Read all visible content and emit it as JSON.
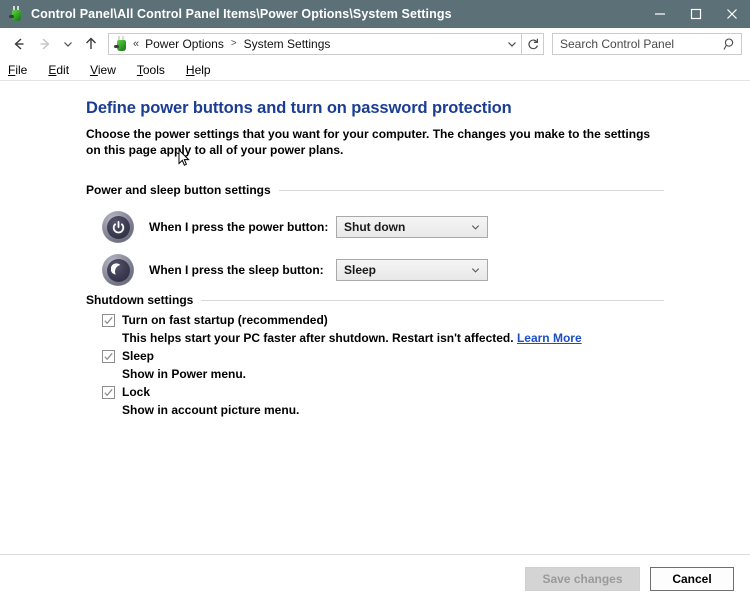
{
  "window": {
    "title": "Control Panel\\All Control Panel Items\\Power Options\\System Settings",
    "icon": "power-plug-icon",
    "titlebar_color": "#5c7078",
    "controls": {
      "minimize": "minimize-button",
      "maximize": "maximize-button",
      "close": "close-button"
    }
  },
  "navbar": {
    "back": "back-button",
    "forward": "forward-button",
    "recent": "recent-locations-button",
    "up": "up-button",
    "breadcrumb": {
      "prefix": "«",
      "items": [
        "Power Options",
        "System Settings"
      ],
      "separator": ">"
    },
    "refresh": "refresh-button",
    "search": {
      "placeholder": "Search Control Panel",
      "value": ""
    }
  },
  "menubar": {
    "items": [
      {
        "accesskey": "F",
        "rest": "ile"
      },
      {
        "accesskey": "E",
        "rest": "dit"
      },
      {
        "accesskey": "V",
        "rest": "iew"
      },
      {
        "accesskey": "T",
        "rest": "ools"
      },
      {
        "accesskey": "H",
        "rest": "elp"
      }
    ]
  },
  "page": {
    "title": "Define power buttons and turn on password protection",
    "title_color": "#1b3e92",
    "description": "Choose the power settings that you want for your computer. The changes you make to the settings on this page apply to all of your power plans."
  },
  "sections": {
    "power_sleep": {
      "label": "Power and sleep button settings",
      "rows": [
        {
          "icon": "power-button-icon",
          "label": "When I press the power button:",
          "value": "Shut down"
        },
        {
          "icon": "sleep-moon-icon",
          "label": "When I press the sleep button:",
          "value": "Sleep"
        }
      ]
    },
    "shutdown": {
      "label": "Shutdown settings",
      "options": [
        {
          "label": "Turn on fast startup (recommended)",
          "checked": true,
          "sub": "This helps start your PC faster after shutdown. Restart isn't affected.",
          "link": "Learn More"
        },
        {
          "label": "Sleep",
          "checked": true,
          "sub": "Show in Power menu.",
          "link": ""
        },
        {
          "label": "Lock",
          "checked": true,
          "sub": "Show in account picture menu.",
          "link": ""
        }
      ]
    }
  },
  "footer": {
    "save_label": "Save changes",
    "save_enabled": false,
    "cancel_label": "Cancel"
  }
}
